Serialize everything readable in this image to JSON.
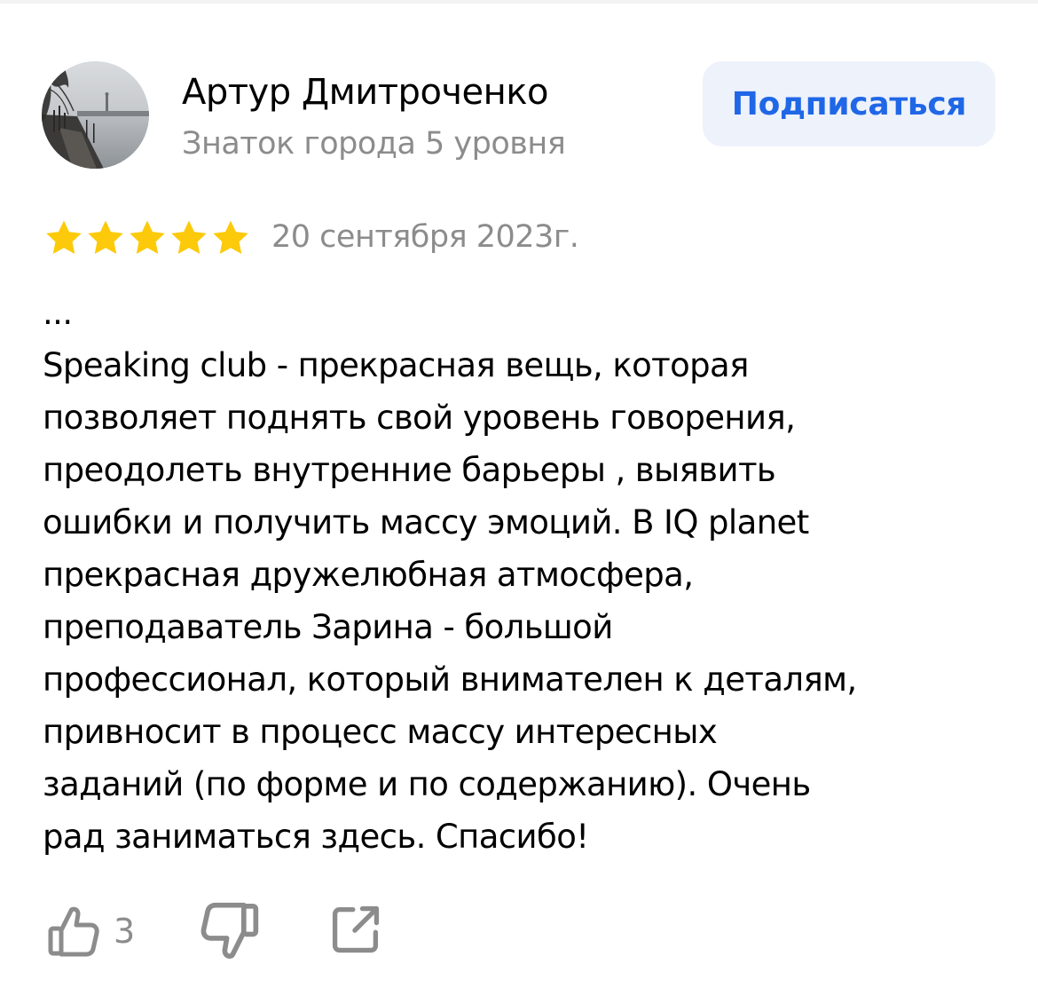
{
  "author": {
    "name": "Артур Дмитроченко",
    "level": "Знаток города 5 уровня",
    "avatar_icon": "avatar-photo"
  },
  "subscribe_label": "Подписаться",
  "review": {
    "rating": 5,
    "rating_max": 5,
    "date": "20 сентября 2023г.",
    "text_lines": [
      "...",
      "Speaking club - прекрасная вещь, которая",
      "позволяет поднять свой уровень говорения,",
      "преодолеть внутренние барьеры , выявить",
      "ошибки и получить массу эмоций. В IQ planet",
      "прекрасная дружелюбная атмосфера,",
      "преподаватель Зарина - большой",
      "профессионал, который внимателен к деталям,",
      "привносит в процесс массу интересных",
      "заданий (по форме и по содержанию). Очень",
      "рад заниматься здесь. Спасибо!"
    ]
  },
  "actions": {
    "likes": "3",
    "like_icon": "thumbs-up-icon",
    "dislike_icon": "thumbs-down-icon",
    "share_icon": "share-icon"
  },
  "colors": {
    "accent": "#1f67e6",
    "button_bg": "#eef2fb",
    "star": "#fcca0a",
    "muted_text": "#8c8c8c",
    "icon": "#8c8c8c"
  }
}
